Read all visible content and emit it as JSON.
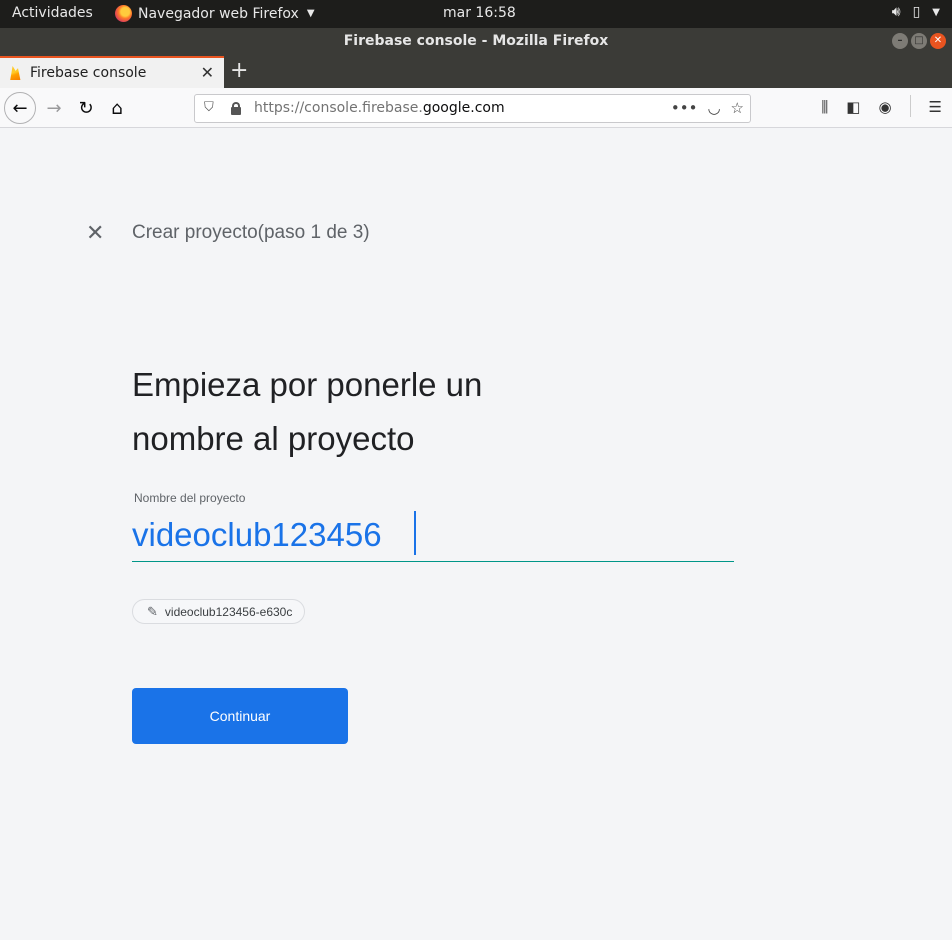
{
  "system_bar": {
    "activities": "Actividades",
    "app_name": "Navegador web Firefox",
    "clock": "mar 16:58"
  },
  "window": {
    "title": "Firebase console - Mozilla Firefox"
  },
  "tabs": [
    {
      "label": "Firebase console",
      "active": true
    }
  ],
  "url": {
    "prefix": "https://console.firebase.",
    "domain": "google.com"
  },
  "page": {
    "step_title": "Crear proyecto(paso 1 de 3)",
    "heading_line1": "Empieza por ponerle un",
    "heading_line2": "nombre al proyecto",
    "field_label": "Nombre del proyecto",
    "project_name": "videoclub123456",
    "project_id": "videoclub123456-e630c",
    "continue_label": "Continuar"
  },
  "colors": {
    "primary": "#1a73e8",
    "underline": "#009688",
    "ubuntu_orange": "#e95420"
  },
  "icons": [
    "firefox-icon",
    "volume-icon",
    "battery-icon",
    "power-menu-icon",
    "firebase-favicon",
    "back-icon",
    "forward-icon",
    "reload-icon",
    "home-icon",
    "shield-icon",
    "lock-icon",
    "page-actions-icon",
    "pocket-icon",
    "bookmark-star-icon",
    "library-icon",
    "sidebar-icon",
    "account-icon",
    "menu-icon",
    "close-icon",
    "pencil-icon"
  ]
}
